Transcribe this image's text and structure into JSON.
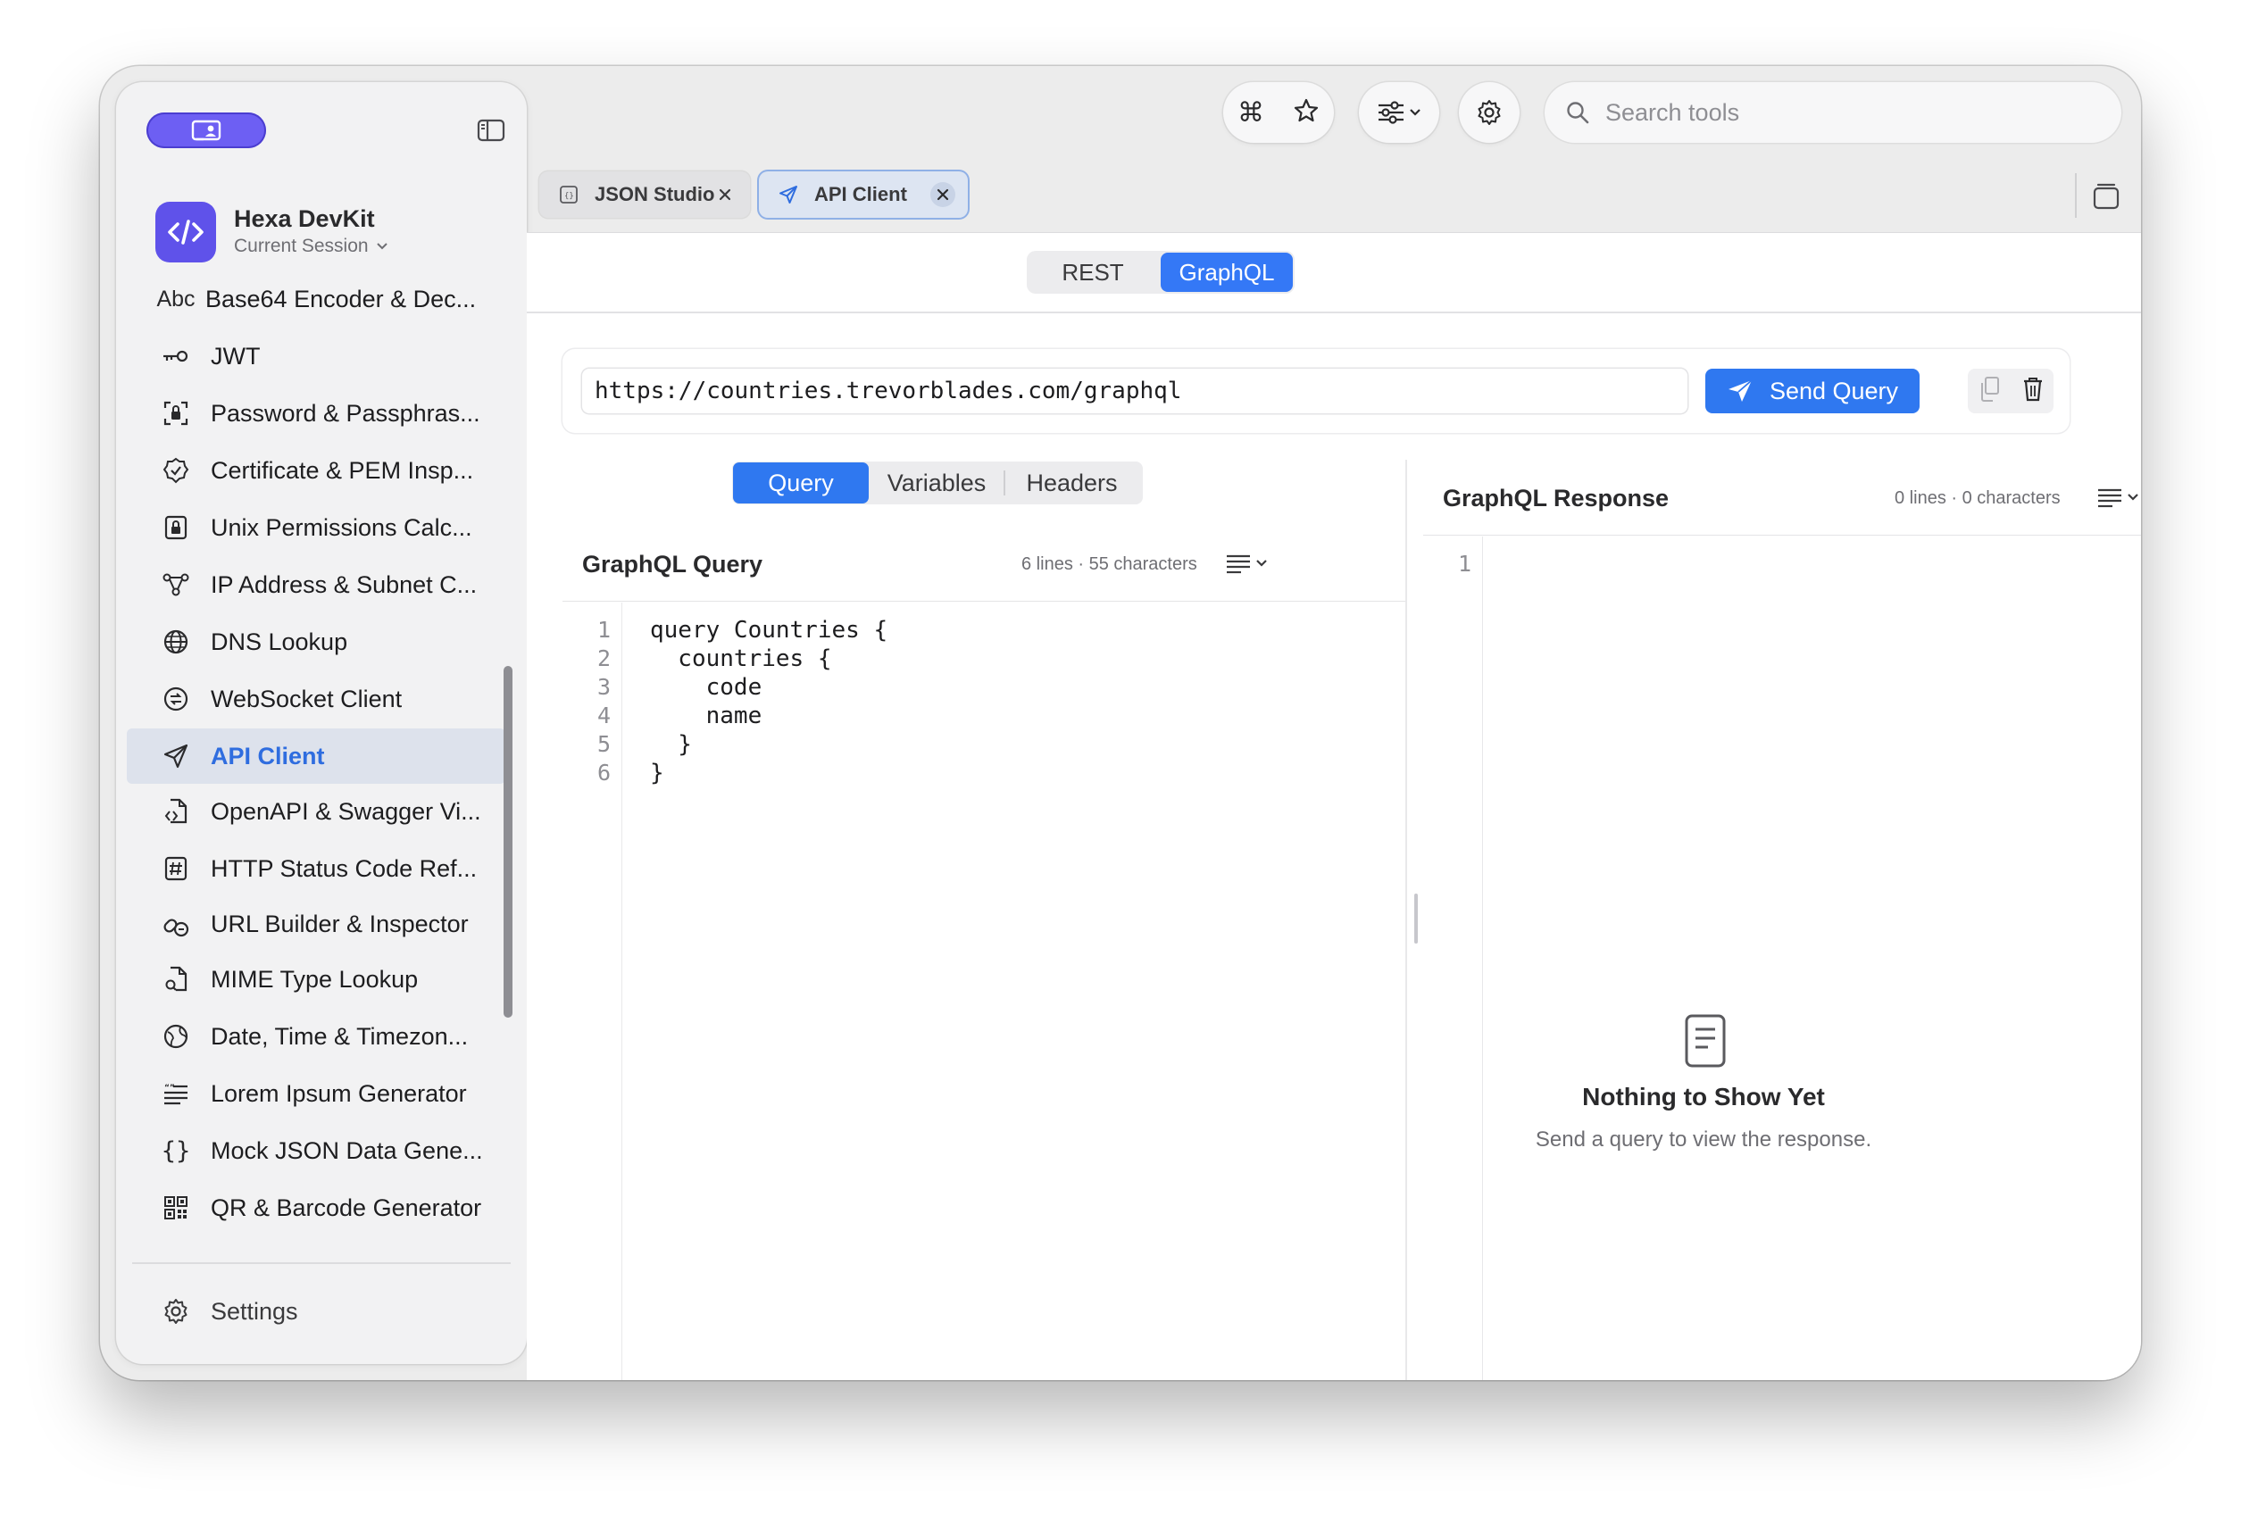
{
  "app": {
    "name": "Hexa DevKit",
    "session": "Current Session"
  },
  "sidebar": {
    "items": [
      {
        "label": "Base64 Encoder & Dec...",
        "icon": "abc-text-icon"
      },
      {
        "label": "JWT",
        "icon": "key-icon"
      },
      {
        "label": "Password & Passphras...",
        "icon": "password-icon"
      },
      {
        "label": "Certificate & PEM Insp...",
        "icon": "certificate-icon"
      },
      {
        "label": "Unix Permissions Calc...",
        "icon": "lock-icon"
      },
      {
        "label": "IP Address & Subnet C...",
        "icon": "network-nodes-icon"
      },
      {
        "label": "DNS Lookup",
        "icon": "globe-icon"
      },
      {
        "label": "WebSocket Client",
        "icon": "websocket-icon"
      },
      {
        "label": "API Client",
        "icon": "paperplane-icon",
        "active": true
      },
      {
        "label": "OpenAPI & Swagger Vi...",
        "icon": "document-code-icon"
      },
      {
        "label": "HTTP Status Code Ref...",
        "icon": "hashtag-icon"
      },
      {
        "label": "URL Builder & Inspector",
        "icon": "link-icon"
      },
      {
        "label": "MIME Type Lookup",
        "icon": "document-search-icon"
      },
      {
        "label": "Date, Time & Timezon...",
        "icon": "clock-globe-icon"
      },
      {
        "label": "Lorem Ipsum Generator",
        "icon": "text-lines-icon"
      },
      {
        "label": "Mock JSON Data Gene...",
        "icon": "braces-icon"
      },
      {
        "label": "QR & Barcode Generator",
        "icon": "qrcode-icon"
      }
    ],
    "settings_label": "Settings"
  },
  "toolbar": {
    "search_placeholder": "Search tools"
  },
  "tabs": [
    {
      "label": "JSON Studio",
      "active": false
    },
    {
      "label": "API Client",
      "active": true
    }
  ],
  "mode": {
    "options": [
      "REST",
      "GraphQL"
    ],
    "selected": "GraphQL"
  },
  "request": {
    "url": "https://countries.trevorblades.com/graphql",
    "send_label": "Send Query"
  },
  "sub_tabs": {
    "options": [
      "Query",
      "Variables",
      "Headers"
    ],
    "selected": "Query"
  },
  "query_panel": {
    "title": "GraphQL Query",
    "meta": "6 lines · 55 characters",
    "line_numbers": [
      "1",
      "2",
      "3",
      "4",
      "5",
      "6"
    ],
    "lines": [
      "query Countries {",
      "  countries {",
      "    code",
      "    name",
      "  }",
      "}"
    ]
  },
  "response_panel": {
    "title": "GraphQL Response",
    "meta": "0 lines · 0 characters",
    "line_numbers": [
      "1"
    ],
    "empty_title": "Nothing to Show Yet",
    "empty_subtitle": "Send a query to view the response."
  },
  "colors": {
    "accent": "#2f78f0",
    "brand": "#5f52ea",
    "active_bg": "#dde2ec"
  }
}
